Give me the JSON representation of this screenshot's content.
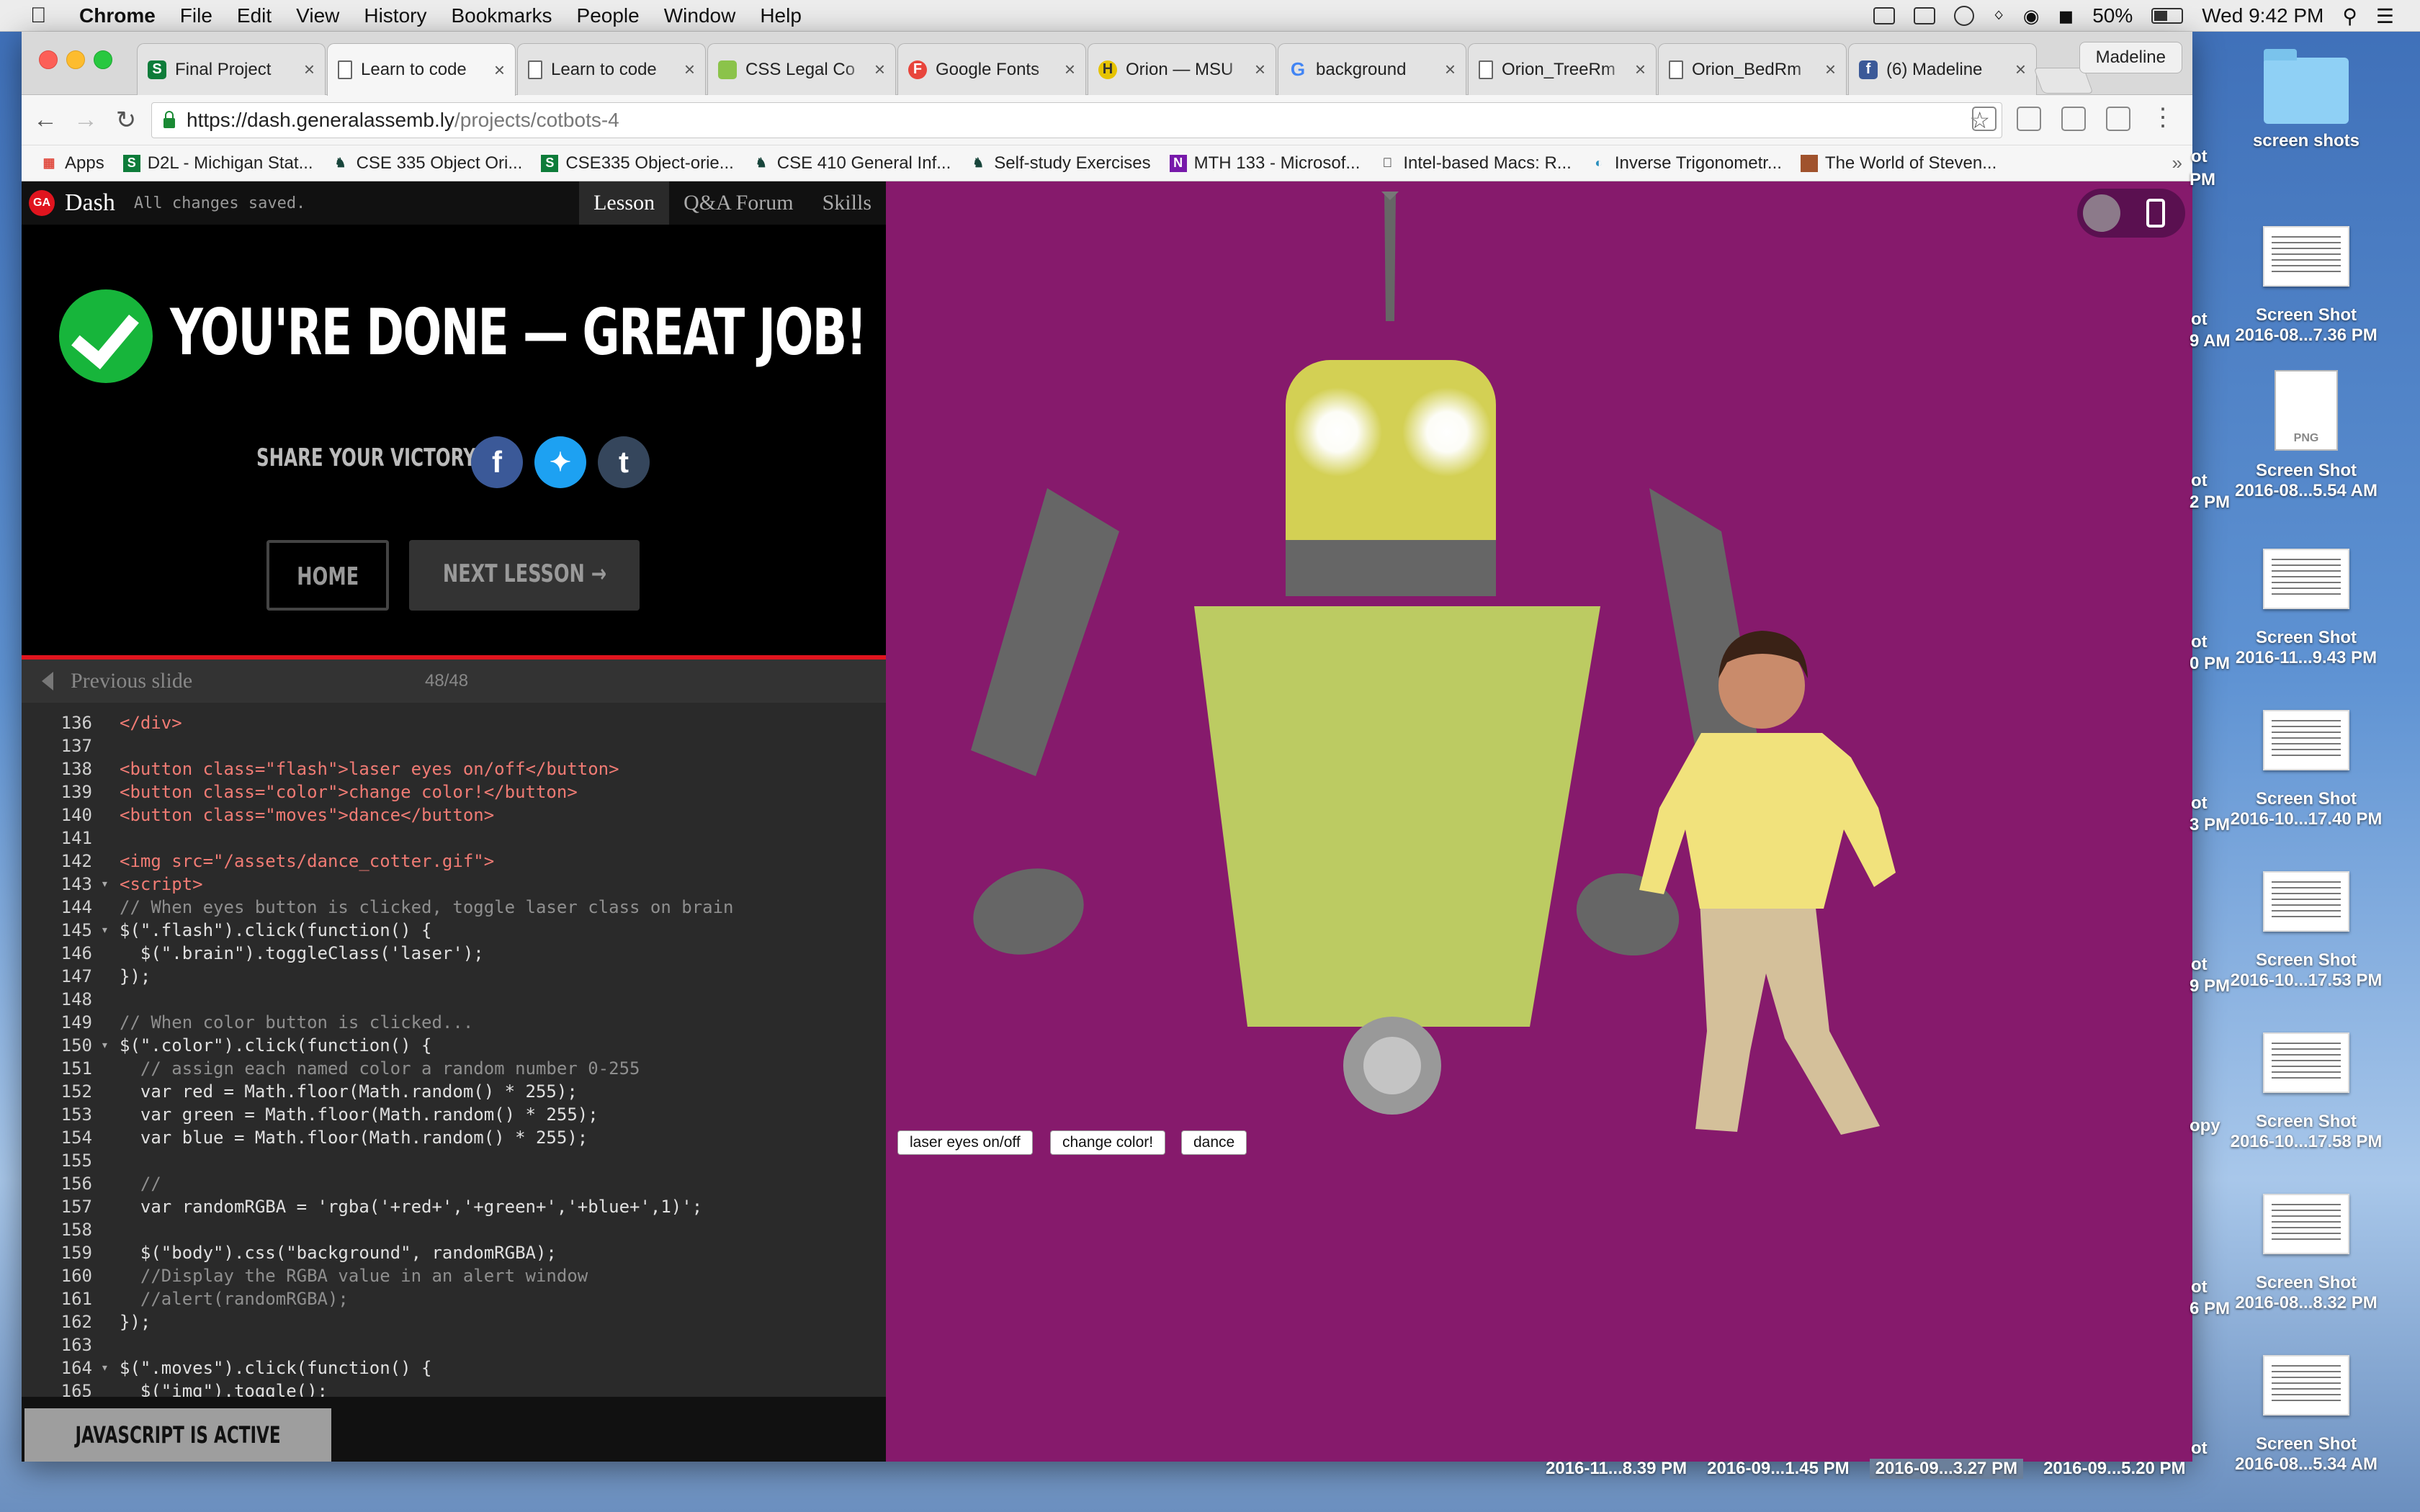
{
  "menubar": {
    "app": "Chrome",
    "items": [
      "File",
      "Edit",
      "View",
      "History",
      "Bookmarks",
      "People",
      "Window",
      "Help"
    ],
    "battery": "50%",
    "clock": "Wed 9:42 PM"
  },
  "browser": {
    "tabs": [
      {
        "title": "Final Project",
        "icon": "S"
      },
      {
        "title": "Learn to code",
        "icon": "doc"
      },
      {
        "title": "Learn to code",
        "icon": "doc"
      },
      {
        "title": "CSS Legal Co",
        "icon": "img"
      },
      {
        "title": "Google Fonts",
        "icon": "F"
      },
      {
        "title": "Orion — MSU",
        "icon": "orion"
      },
      {
        "title": "background",
        "icon": "G"
      },
      {
        "title": "Orion_TreeRm",
        "icon": "doc"
      },
      {
        "title": "Orion_BedRm",
        "icon": "doc"
      },
      {
        "title": "(6) Madeline",
        "icon": "f"
      }
    ],
    "profile": "Madeline",
    "url_host": "https://dash.generalassemb.ly",
    "url_path": "/projects/cotbots-4",
    "bookmarks": [
      "Apps",
      "D2L - Michigan Stat...",
      "CSE 335 Object Ori...",
      "CSE335 Object-orie...",
      "CSE 410 General Inf...",
      "Self-study Exercises",
      "MTH 133 - Microsof...",
      "Intel-based Macs: R...",
      "Inverse Trigonometr...",
      "The World of Steven..."
    ]
  },
  "dash": {
    "logo": "GA",
    "name": "Dash",
    "status": "All changes saved.",
    "tabs": [
      "Lesson",
      "Q&A Forum",
      "Skills"
    ],
    "done_title": "YOU'RE DONE — GREAT JOB!",
    "share_label": "SHARE YOUR VICTORY:",
    "home_button": "HOME",
    "next_button": "NEXT LESSON →",
    "prev_slide": "Previous slide",
    "slide_count": "48/48",
    "js_status": "JAVASCRIPT IS ACTIVE"
  },
  "code_lines": [
    {
      "n": "136",
      "fold": "",
      "text": "</div>"
    },
    {
      "n": "137",
      "fold": "",
      "text": ""
    },
    {
      "n": "138",
      "fold": "",
      "text": "<button class=\"flash\">laser eyes on/off</button>"
    },
    {
      "n": "139",
      "fold": "",
      "text": "<button class=\"color\">change color!</button>"
    },
    {
      "n": "140",
      "fold": "",
      "text": "<button class=\"moves\">dance</button>"
    },
    {
      "n": "141",
      "fold": "",
      "text": ""
    },
    {
      "n": "142",
      "fold": "",
      "text": "<img src=\"/assets/dance_cotter.gif\">"
    },
    {
      "n": "143",
      "fold": "▾",
      "text": "<script>"
    },
    {
      "n": "144",
      "fold": "",
      "text": "// When eyes button is clicked, toggle laser class on brain"
    },
    {
      "n": "145",
      "fold": "▾",
      "text": "$(\".flash\").click(function() {"
    },
    {
      "n": "146",
      "fold": "",
      "text": "  $(\".brain\").toggleClass('laser');"
    },
    {
      "n": "147",
      "fold": "",
      "text": "});"
    },
    {
      "n": "148",
      "fold": "",
      "text": ""
    },
    {
      "n": "149",
      "fold": "",
      "text": "// When color button is clicked..."
    },
    {
      "n": "150",
      "fold": "▾",
      "text": "$(\".color\").click(function() {"
    },
    {
      "n": "151",
      "fold": "",
      "text": "  // assign each named color a random number 0-255"
    },
    {
      "n": "152",
      "fold": "",
      "text": "  var red = Math.floor(Math.random() * 255);"
    },
    {
      "n": "153",
      "fold": "",
      "text": "  var green = Math.floor(Math.random() * 255);"
    },
    {
      "n": "154",
      "fold": "",
      "text": "  var blue = Math.floor(Math.random() * 255);"
    },
    {
      "n": "155",
      "fold": "",
      "text": ""
    },
    {
      "n": "156",
      "fold": "",
      "text": "  //"
    },
    {
      "n": "157",
      "fold": "",
      "text": "  var randomRGBA = 'rgba('+red+','+green+','+blue+',1)';"
    },
    {
      "n": "158",
      "fold": "",
      "text": ""
    },
    {
      "n": "159",
      "fold": "",
      "text": "  $(\"body\").css(\"background\", randomRGBA);"
    },
    {
      "n": "160",
      "fold": "",
      "text": "  //Display the RGBA value in an alert window"
    },
    {
      "n": "161",
      "fold": "",
      "text": "  //alert(randomRGBA);"
    },
    {
      "n": "162",
      "fold": "",
      "text": "});"
    },
    {
      "n": "163",
      "fold": "",
      "text": ""
    },
    {
      "n": "164",
      "fold": "▾",
      "text": "$(\".moves\").click(function() {"
    },
    {
      "n": "165",
      "fold": "",
      "text": "  $(\"img\").toggle();"
    }
  ],
  "preview": {
    "buttons": [
      "laser eyes on/off",
      "change color!",
      "dance"
    ],
    "background": "#861a6c",
    "robot_head": "#d3d054",
    "robot_body": "#bccb62",
    "robot_gray": "#666666"
  },
  "desktop": {
    "folder_label": "screen shots",
    "icons": [
      {
        "line1": "Screen Shot",
        "line2": "2016-08...7.36 PM"
      },
      {
        "line1": "Screen Shot",
        "line2": "2016-08...5.54 AM"
      },
      {
        "line1": "Screen Shot",
        "line2": "2016-11...9.43 PM"
      },
      {
        "line1": "Screen Shot",
        "line2": "2016-10...17.40 PM"
      },
      {
        "line1": "Screen Shot",
        "line2": "2016-10...17.53 PM"
      },
      {
        "line1": "Screen Shot",
        "line2": "2016-10...17.58 PM"
      },
      {
        "line1": "Screen Shot",
        "line2": "2016-08...8.32 PM"
      },
      {
        "line1": "Screen Shot",
        "line2": "2016-08...5.34 AM"
      }
    ],
    "png_badge": "PNG",
    "partial_labels": [
      "ot",
      "PM",
      "ot",
      "9 AM",
      "ot",
      "2 PM",
      "ot",
      "0 PM",
      "ot",
      "3 PM",
      "ot",
      "9 PM",
      "opy",
      "ot",
      "6 PM",
      "ot"
    ],
    "bottom_labels": [
      "2016-11...8.39 PM",
      "2016-09...1.45 PM",
      "2016-09...3.27 PM",
      "2016-09...5.20 PM"
    ]
  }
}
